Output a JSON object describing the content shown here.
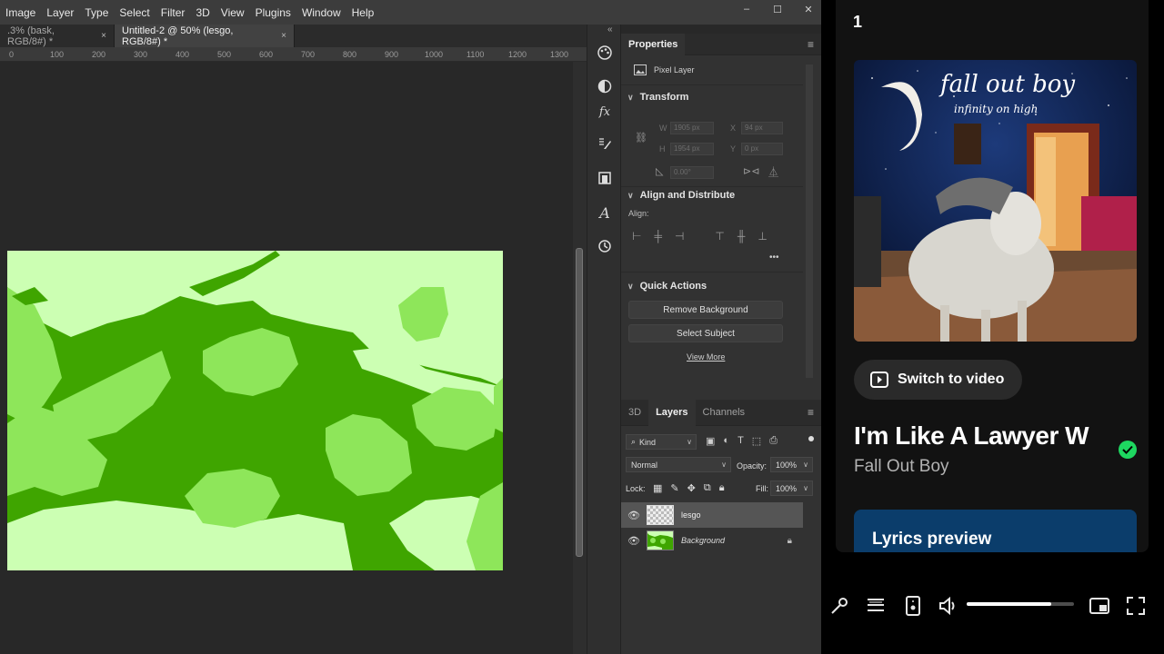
{
  "photoshop": {
    "menu": [
      "Image",
      "Layer",
      "Type",
      "Select",
      "Filter",
      "3D",
      "View",
      "Plugins",
      "Window",
      "Help"
    ],
    "window_controls": [
      "–",
      "☐",
      "✕"
    ],
    "tabs": [
      {
        "label": ".3% (bask, RGB/8#) *",
        "close": "×"
      },
      {
        "label": "Untitled-2 @ 50% (lesgo, RGB/8#) *",
        "close": "×"
      }
    ],
    "ruler_ticks": [
      "0",
      "100",
      "200",
      "300",
      "400",
      "500",
      "600",
      "700",
      "800",
      "900",
      "1000",
      "1100",
      "1200",
      "1300"
    ],
    "properties": {
      "tab": "Properties",
      "layer_type": "Pixel Layer",
      "transform": {
        "title": "Transform",
        "w_label": "W",
        "w_value": "1905 px",
        "x_label": "X",
        "x_value": "94 px",
        "h_label": "H",
        "h_value": "1954 px",
        "y_label": "Y",
        "y_value": "0 px",
        "angle_value": "0.00°"
      },
      "align": {
        "title": "Align and Distribute",
        "align_label": "Align:",
        "more": "•••"
      },
      "quick_actions": {
        "title": "Quick Actions",
        "remove_bg": "Remove Background",
        "select_subject": "Select Subject",
        "view_more": "View More"
      }
    },
    "layers_panel": {
      "tabs": [
        "3D",
        "Layers",
        "Channels"
      ],
      "active_tab": "Layers",
      "kind": "Kind",
      "blend_mode": "Normal",
      "opacity_label": "Opacity:",
      "opacity_value": "100%",
      "lock_label": "Lock:",
      "fill_label": "Fill:",
      "fill_value": "100%",
      "layers": [
        {
          "name": "lesgo",
          "selected": true
        },
        {
          "name": "Background",
          "selected": false,
          "locked": true
        }
      ]
    }
  },
  "spotify": {
    "queue_number": "1",
    "album_text": {
      "band": "fall out boy",
      "album": "infinity on high"
    },
    "switch_button": "Switch to video",
    "song_title": "I'm Like A Lawyer W",
    "artist": "Fall Out Boy",
    "lyrics_label": "Lyrics preview",
    "volume_level": 0.79,
    "colors": {
      "green": "#1ed760",
      "lyrics_bg": "#0b3d6b"
    }
  }
}
